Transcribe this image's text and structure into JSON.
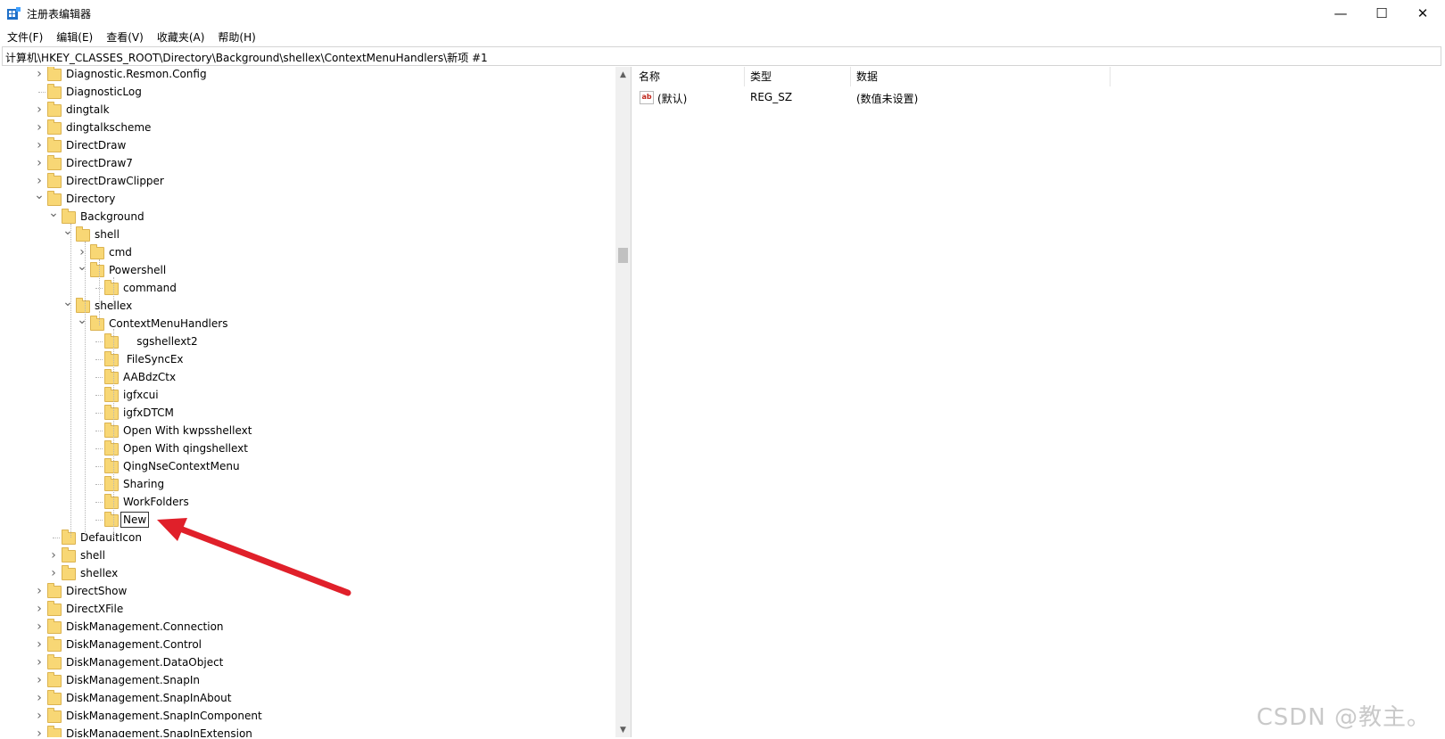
{
  "window": {
    "title": "注册表编辑器",
    "minimize_icon": "—",
    "maximize_icon": "☐",
    "close_icon": "✕"
  },
  "menu": [
    "文件(F)",
    "编辑(E)",
    "查看(V)",
    "收藏夹(A)",
    "帮助(H)"
  ],
  "address": "计算机\\HKEY_CLASSES_ROOT\\Directory\\Background\\shellex\\ContextMenuHandlers\\新项 #1",
  "tree": [
    {
      "label": "Diagnostic.Resmon.Config",
      "expander": "collapsed"
    },
    {
      "label": "DiagnosticLog",
      "expander": "none"
    },
    {
      "label": "dingtalk",
      "expander": "collapsed"
    },
    {
      "label": "dingtalkscheme",
      "expander": "collapsed"
    },
    {
      "label": "DirectDraw",
      "expander": "collapsed"
    },
    {
      "label": "DirectDraw7",
      "expander": "collapsed"
    },
    {
      "label": "DirectDrawClipper",
      "expander": "collapsed"
    },
    {
      "label": "Directory",
      "expander": "expanded"
    },
    {
      "label": "Background",
      "expander": "expanded"
    },
    {
      "label": "shell",
      "expander": "expanded"
    },
    {
      "label": "cmd",
      "expander": "collapsed"
    },
    {
      "label": "Powershell",
      "expander": "expanded"
    },
    {
      "label": "command",
      "expander": "none"
    },
    {
      "label": "shellex",
      "expander": "expanded"
    },
    {
      "label": "ContextMenuHandlers",
      "expander": "expanded"
    },
    {
      "label": "    sgshellext2",
      "expander": "none"
    },
    {
      "label": " FileSyncEx",
      "expander": "none"
    },
    {
      "label": "AABdzCtx",
      "expander": "none"
    },
    {
      "label": "igfxcui",
      "expander": "none"
    },
    {
      "label": "igfxDTCM",
      "expander": "none"
    },
    {
      "label": "Open With kwpsshellext",
      "expander": "none"
    },
    {
      "label": "Open With qingshellext",
      "expander": "none"
    },
    {
      "label": "QingNseContextMenu",
      "expander": "none"
    },
    {
      "label": "Sharing",
      "expander": "none"
    },
    {
      "label": "WorkFolders",
      "expander": "none"
    },
    {
      "label": "New",
      "expander": "none",
      "editing": true
    },
    {
      "label": "DefaultIcon",
      "expander": "none"
    },
    {
      "label": "shell",
      "expander": "collapsed"
    },
    {
      "label": "shellex",
      "expander": "collapsed"
    },
    {
      "label": "DirectShow",
      "expander": "collapsed"
    },
    {
      "label": "DirectXFile",
      "expander": "collapsed"
    },
    {
      "label": "DiskManagement.Connection",
      "expander": "collapsed"
    },
    {
      "label": "DiskManagement.Control",
      "expander": "collapsed"
    },
    {
      "label": "DiskManagement.DataObject",
      "expander": "collapsed"
    },
    {
      "label": "DiskManagement.SnapIn",
      "expander": "collapsed"
    },
    {
      "label": "DiskManagement.SnapInAbout",
      "expander": "collapsed"
    },
    {
      "label": "DiskManagement.SnapInComponent",
      "expander": "collapsed"
    },
    {
      "label": "DiskManagement.SnapInExtension",
      "expander": "collapsed"
    }
  ],
  "values_table": {
    "headers": [
      "名称",
      "类型",
      "数据"
    ],
    "rows": [
      {
        "icon": "ab",
        "name": "(默认)",
        "type": "REG_SZ",
        "data": "(数值未设置)"
      }
    ]
  },
  "annotation": {
    "arrow_color": "#e0202a"
  },
  "watermark": "CSDN @教主。",
  "colors": {
    "folder": "#f8d775",
    "edit_border": "#333333"
  }
}
